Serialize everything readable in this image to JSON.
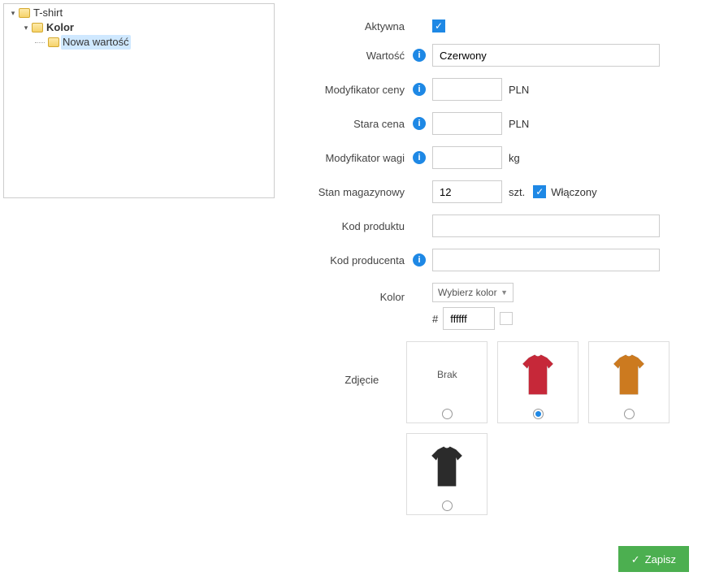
{
  "tree": {
    "root": {
      "label": "T-shirt"
    },
    "attr": {
      "label": "Kolor"
    },
    "value": {
      "label": "Nowa wartość"
    }
  },
  "form": {
    "active": {
      "label": "Aktywna",
      "checked": true
    },
    "value": {
      "label": "Wartość",
      "text": "Czerwony"
    },
    "price_mod": {
      "label": "Modyfikator ceny",
      "text": "",
      "unit": "PLN"
    },
    "old_price": {
      "label": "Stara cena",
      "text": "",
      "unit": "PLN"
    },
    "weight_mod": {
      "label": "Modyfikator wagi",
      "text": "",
      "unit": "kg"
    },
    "stock": {
      "label": "Stan magazynowy",
      "text": "12",
      "unit": "szt.",
      "toggle": {
        "checked": true,
        "label": "Włączony"
      }
    },
    "product_code": {
      "label": "Kod produktu",
      "text": ""
    },
    "manufacturer_code": {
      "label": "Kod producenta",
      "text": ""
    },
    "color": {
      "label": "Kolor",
      "select_placeholder": "Wybierz kolor",
      "hash": "#",
      "hex": "ffffff"
    },
    "image": {
      "label": "Zdjęcie",
      "none_label": "Brak",
      "options": [
        {
          "kind": "none",
          "selected": false
        },
        {
          "kind": "tshirt",
          "fill": "#c62839",
          "selected": true
        },
        {
          "kind": "tshirt",
          "fill": "#cc7a1f",
          "selected": false
        },
        {
          "kind": "tshirt",
          "fill": "#2b2b2b",
          "selected": false
        }
      ]
    }
  },
  "footer": {
    "save": "Zapisz"
  }
}
